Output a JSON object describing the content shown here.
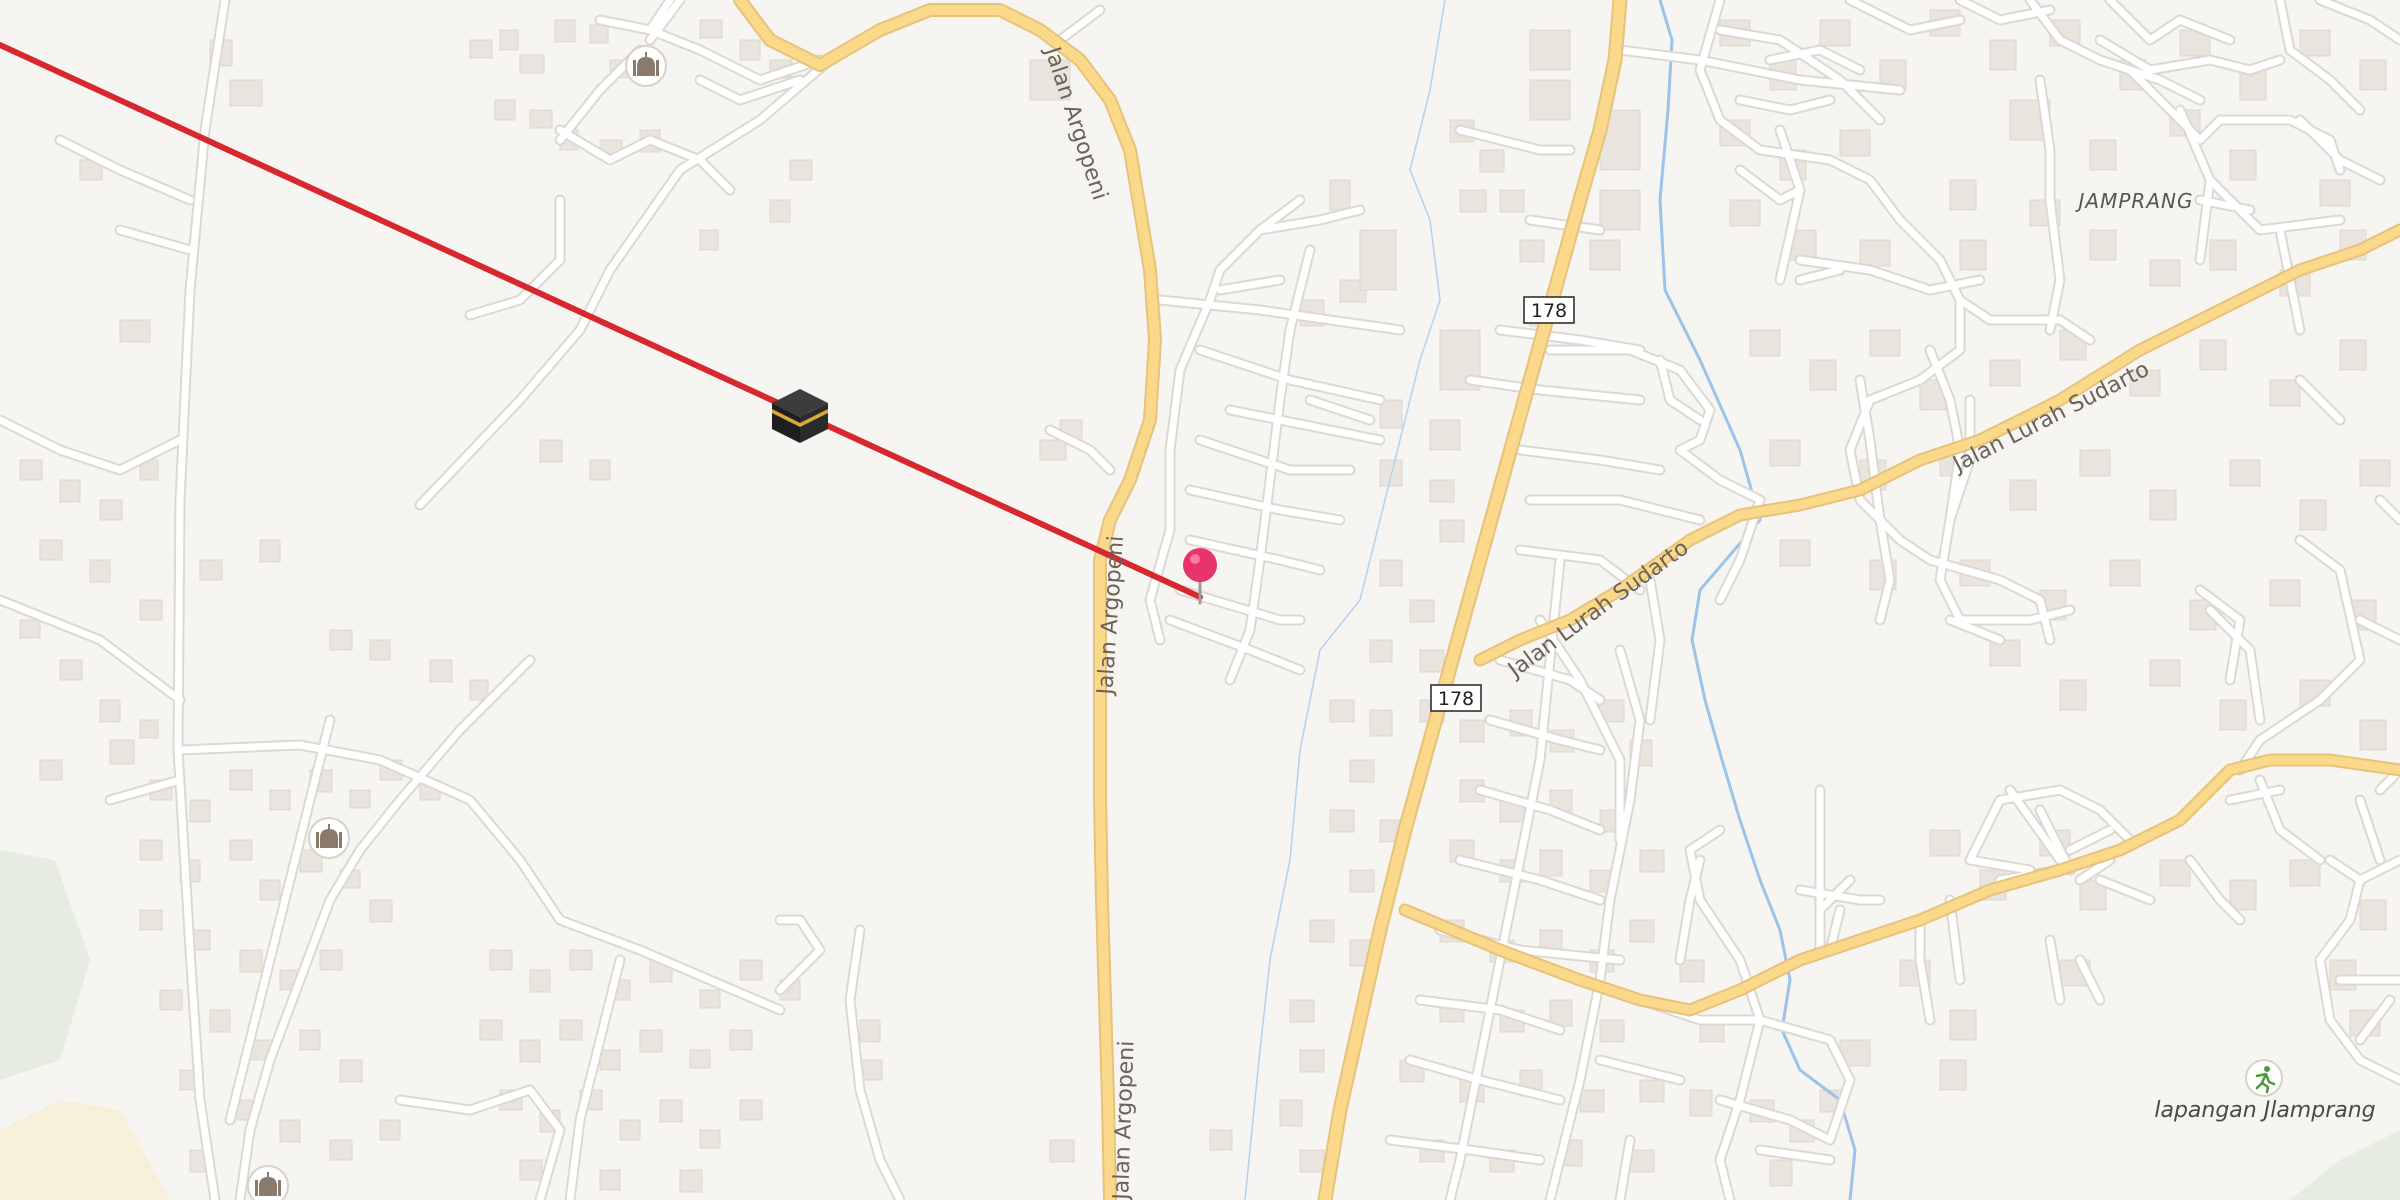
{
  "map": {
    "roads": [
      {
        "name": "Jalan Argopeni"
      },
      {
        "name": "Jalan Argopeni"
      },
      {
        "name": "Jalan Argopeni"
      },
      {
        "name": "Jalan Lurah Sudarto"
      },
      {
        "name": "Jalan Lurah Sudarto"
      }
    ],
    "shields": [
      {
        "ref": "178"
      },
      {
        "ref": "178"
      }
    ],
    "places": [
      {
        "name": "JAMPRANG"
      }
    ],
    "pois": [
      {
        "name": "lapangan Jlamprang",
        "icon": "running-person-icon"
      }
    ],
    "markers": {
      "location_pin": {
        "icon": "map-pin-icon",
        "color": "#e8336d"
      },
      "kaaba": {
        "icon": "kaaba-icon"
      },
      "mosques": [
        {
          "icon": "mosque-icon"
        },
        {
          "icon": "mosque-icon"
        },
        {
          "icon": "mosque-icon"
        }
      ]
    },
    "qibla_line": {
      "color": "#d8282f"
    },
    "colors": {
      "background": "#f7f5f2",
      "minor_road": "#ffffff",
      "road_casing": "#dcd8d2",
      "primary_road": "#fbd98b",
      "primary_casing": "#e7c27a",
      "building": "#e9e4dd",
      "river": "#9cc3ea",
      "park": "#e6ede0"
    }
  }
}
